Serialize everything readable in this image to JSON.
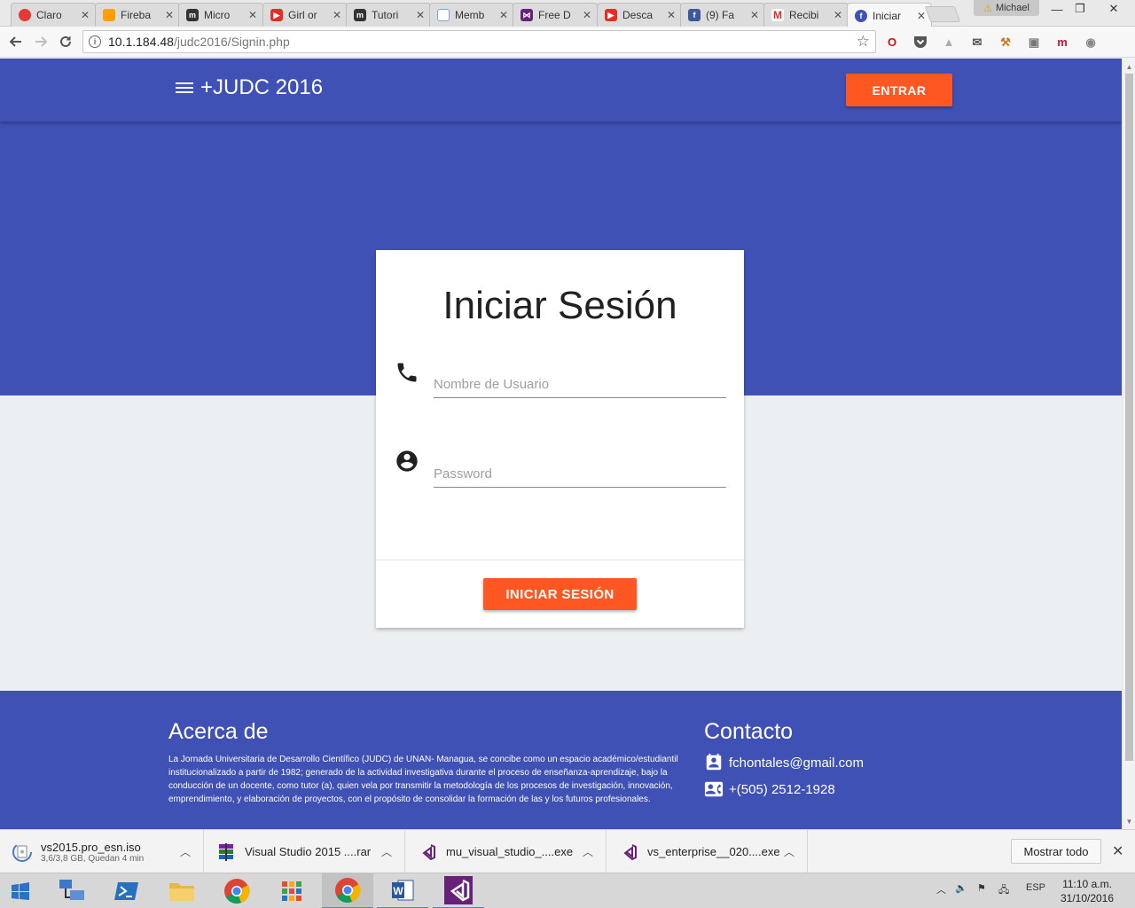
{
  "browser": {
    "tabs": [
      {
        "label": "Claro",
        "icon": "claro-icon",
        "color": "#e53935"
      },
      {
        "label": "Fireba",
        "icon": "firebase-icon",
        "color": "#ffa000"
      },
      {
        "label": "Micro",
        "icon": "medium-icon",
        "color": "#333333"
      },
      {
        "label": "Girl or",
        "icon": "youtube-icon",
        "color": "#e52d27"
      },
      {
        "label": "Tutori",
        "icon": "medium-icon",
        "color": "#333333"
      },
      {
        "label": "Memb",
        "icon": "document-icon",
        "color": "#7ca3d8"
      },
      {
        "label": "Free D",
        "icon": "visual-studio-icon",
        "color": "#68217a"
      },
      {
        "label": "Desca",
        "icon": "youtube-icon",
        "color": "#e52d27"
      },
      {
        "label": "(9) Fa",
        "icon": "facebook-icon",
        "color": "#3b5998"
      },
      {
        "label": "Recibi",
        "icon": "gmail-icon",
        "color": "#d93025"
      },
      {
        "label": "Iniciar",
        "icon": "page-icon",
        "color": "#3f51b5",
        "active": true
      }
    ],
    "profile_name": "Michael",
    "url_host": "10.1.184.48",
    "url_path": "/judc2016/Signin.php"
  },
  "page": {
    "brand": "+JUDC 2016",
    "enter_button": "ENTRAR",
    "login_card": {
      "title": "Iniciar Sesión",
      "username_placeholder": "Nombre de Usuario",
      "password_placeholder": "Password",
      "submit_button": "INICIAR SESIÓN"
    },
    "footer": {
      "about_title": "Acerca de",
      "about_text": "La Jornada Universitaria de Desarrollo Científico (JUDC) de UNAN- Managua, se concibe como un espacio académico/estudiantil institucionalizado a partir de 1982; generado de la actividad investigativa durante el proceso de enseñanza-aprendizaje, bajo la conducción de un docente, como tutor (a), quien vela por transmitir la metodología de los procesos de investigación, innovación, emprendimiento, y elaboración de proyectos, con el propósito de consolidar la formación de las y los futuros profesionales.",
      "contact_title": "Contacto",
      "email": "fchontales@gmail.com",
      "phone": "+(505) 2512-1928"
    }
  },
  "downloads": {
    "items": [
      {
        "name": "vs2015.pro_esn.iso",
        "sub": "3,6/3,8 GB, Quedan 4 min",
        "icon": "disc-image-icon"
      },
      {
        "name": "Visual Studio 2015 ....rar",
        "sub": "",
        "icon": "winrar-icon"
      },
      {
        "name": "mu_visual_studio_....exe",
        "sub": "",
        "icon": "visual-studio-icon"
      },
      {
        "name": "vs_enterprise__020....exe",
        "sub": "",
        "icon": "visual-studio-icon"
      }
    ],
    "show_all": "Mostrar todo"
  },
  "taskbar": {
    "language": "ESP",
    "time": "11:10 a.m.",
    "date": "31/10/2016"
  },
  "colors": {
    "primary": "#3f51b5",
    "accent": "#ff5722",
    "background": "#eceff1"
  }
}
